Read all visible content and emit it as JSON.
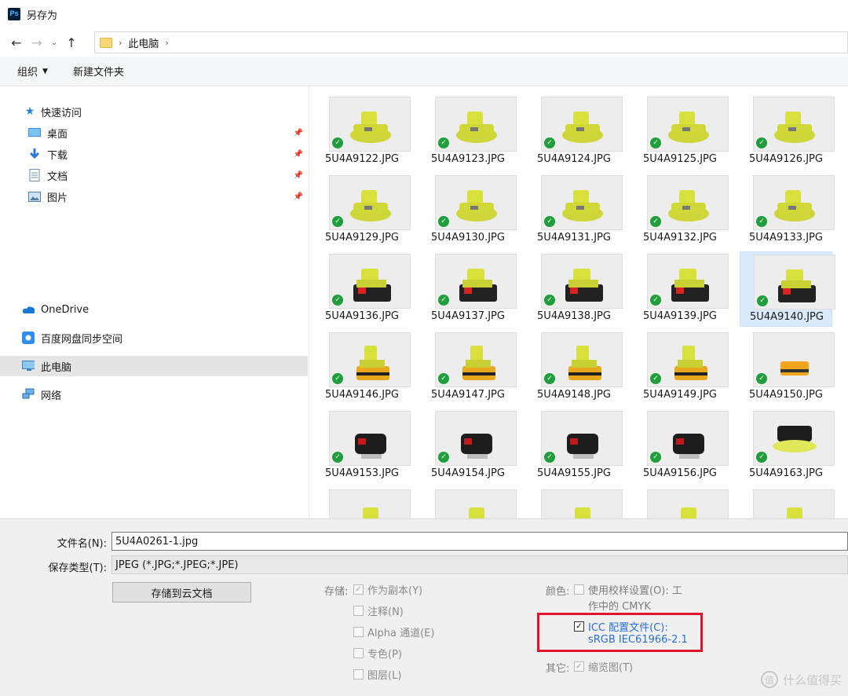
{
  "window": {
    "title": "另存为",
    "app_icon": "Ps"
  },
  "address": {
    "crumbs": [
      "此电脑"
    ],
    "sep": "›"
  },
  "toolbar": {
    "organize": "组织",
    "new_folder": "新建文件夹"
  },
  "sidebar": {
    "quick_access": "快速访问",
    "items": [
      {
        "label": "桌面",
        "icon": "desktop-icon",
        "pinned": true
      },
      {
        "label": "下载",
        "icon": "download-icon",
        "pinned": true
      },
      {
        "label": "文档",
        "icon": "document-icon",
        "pinned": true
      },
      {
        "label": "图片",
        "icon": "pictures-icon",
        "pinned": true
      }
    ],
    "onedrive": "OneDrive",
    "baidu": "百度网盘同步空间",
    "this_pc": "此电脑",
    "network": "网络"
  },
  "files": [
    "5U4A9122.JPG",
    "5U4A9123.JPG",
    "5U4A9124.JPG",
    "5U4A9125.JPG",
    "5U4A9126.JPG",
    "5U4A9129.JPG",
    "5U4A9130.JPG",
    "5U4A9131.JPG",
    "5U4A9132.JPG",
    "5U4A9133.JPG",
    "5U4A9136.JPG",
    "5U4A9137.JPG",
    "5U4A9138.JPG",
    "5U4A9139.JPG",
    "5U4A9140.JPG",
    "5U4A9146.JPG",
    "5U4A9147.JPG",
    "5U4A9148.JPG",
    "5U4A9149.JPG",
    "5U4A9150.JPG",
    "5U4A9153.JPG",
    "5U4A9154.JPG",
    "5U4A9155.JPG",
    "5U4A9156.JPG",
    "5U4A9163.JPG"
  ],
  "selected_file": "5U4A9140.JPG",
  "form": {
    "filename_label": "文件名(N):",
    "filename_value": "5U4A0261-1.jpg",
    "type_label": "保存类型(T):",
    "type_value": "JPEG (*.JPG;*.JPEG;*.JPE)",
    "cloud_button": "存储到云文档"
  },
  "save_opts": {
    "group": "存储:",
    "as_copy": "作为副本(Y)",
    "notes": "注释(N)",
    "alpha": "Alpha 通道(E)",
    "spot": "专色(P)",
    "layers": "图层(L)"
  },
  "color_opts": {
    "group": "颜色:",
    "proof_line1": "使用校样设置(O): 工",
    "proof_line2": "作中的 CMYK",
    "icc_line1": "ICC 配置文件(C):",
    "icc_line2": "sRGB IEC61966-2.1"
  },
  "other_opts": {
    "group": "其它:",
    "thumbnail": "缩览图(T)"
  },
  "watermark": {
    "glyph": "值",
    "text": "什么值得买"
  },
  "colors": {
    "accent": "#e0152d",
    "selected_tile": "#d8eafb",
    "check": "#1f9e3c",
    "link": "#2a6fd6"
  }
}
